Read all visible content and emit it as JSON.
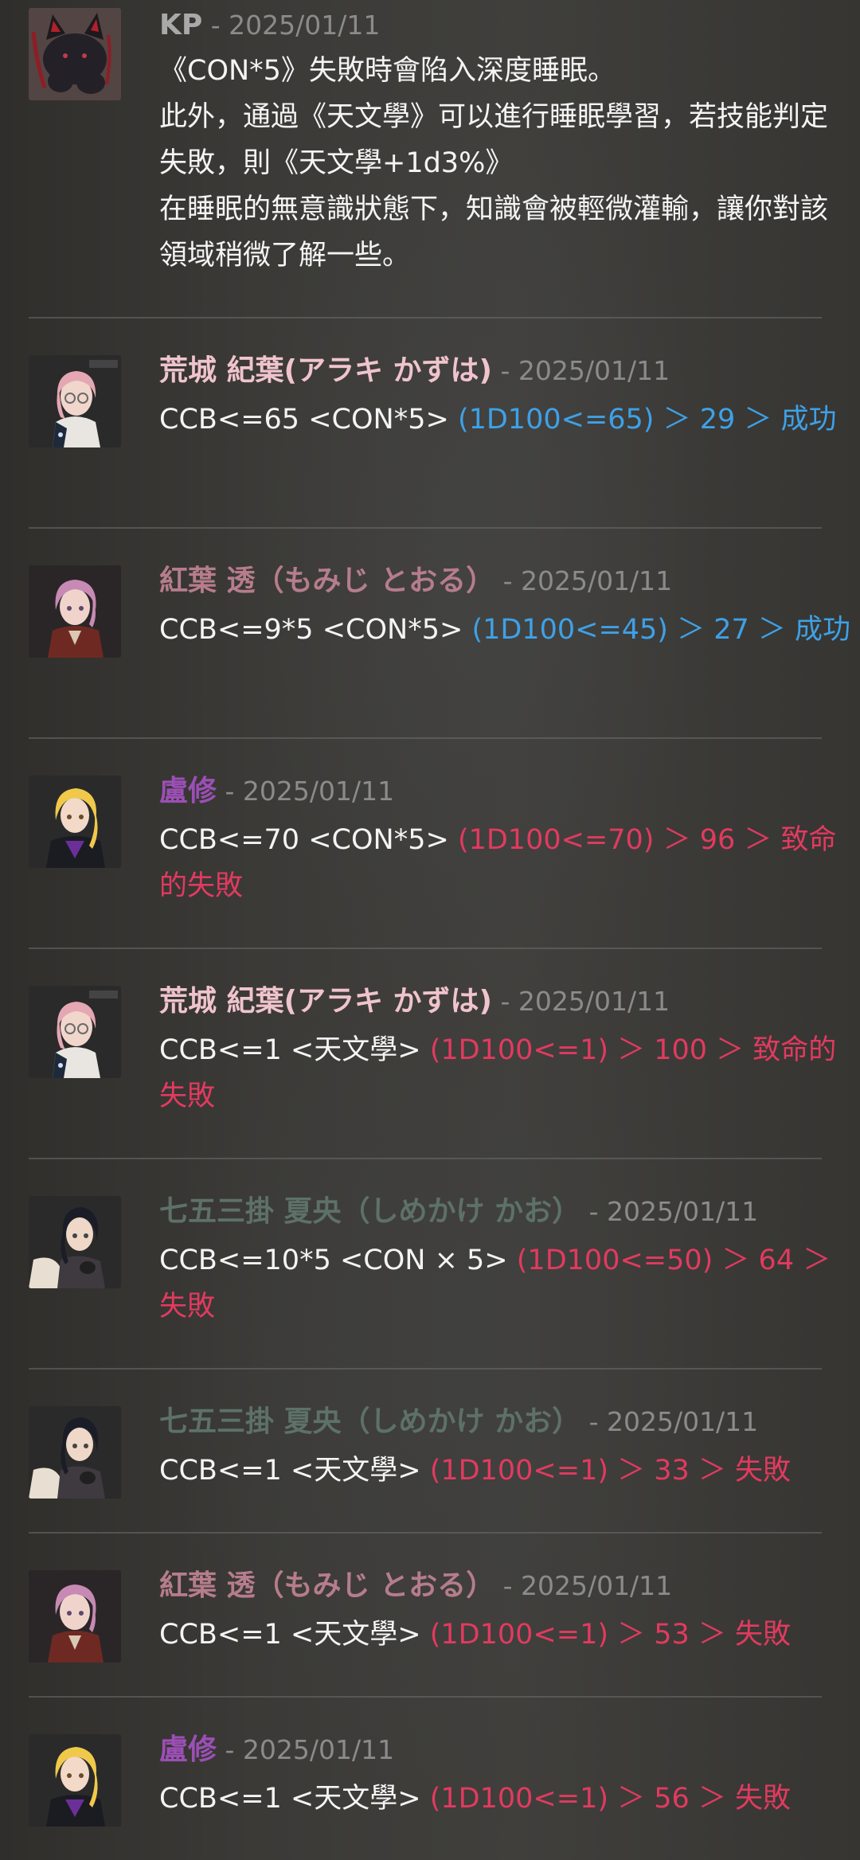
{
  "separator": " - ",
  "colors": {
    "success": "#3ea1e6",
    "failure": "#e23a5f",
    "kp": "#a9a9a9",
    "kazuha": "#f0c4cc",
    "toru": "#b67d8c",
    "roshu": "#9c4fb6",
    "kao": "#5d7168"
  },
  "messages": [
    {
      "author": "KP",
      "date": "2025/01/11",
      "lines": [
        "《CON*5》失敗時會陷入深度睡眠。",
        "此外，通過《天文學》可以進行睡眠學習，若技能判定失敗，則《天文學+1d3%》",
        "在睡眠的無意識狀態下，知識會被輕微灌輸，讓你對該領域稍微了解一些。"
      ]
    },
    {
      "author": "荒城 紀葉(アラキ かずは)",
      "date": "2025/01/11",
      "command": "CCB<=65 <CON*5>",
      "result": "(1D100<=65) ＞ 29 ＞ 成功"
    },
    {
      "author": "紅葉 透（もみじ とおる）",
      "date": "2025/01/11",
      "command": "CCB<=9*5 <CON*5>",
      "result": "(1D100<=45) ＞ 27 ＞ 成功"
    },
    {
      "author": "盧修",
      "date": "2025/01/11",
      "command": "CCB<=70 <CON*5>",
      "result": "(1D100<=70) ＞ 96 ＞ 致命的失敗"
    },
    {
      "author": "荒城 紀葉(アラキ かずは)",
      "date": "2025/01/11",
      "command": "CCB<=1 <天文學>",
      "result": "(1D100<=1) ＞ 100 ＞ 致命的失敗"
    },
    {
      "author": "七五三掛 夏央（しめかけ かお）",
      "date": "2025/01/11",
      "command": "CCB<=10*5 <CON × 5>",
      "result": "(1D100<=50) ＞ 64 ＞ 失敗"
    },
    {
      "author": "七五三掛 夏央（しめかけ かお）",
      "date": "2025/01/11",
      "command": "CCB<=1 <天文學>",
      "result": "(1D100<=1) ＞ 33 ＞ 失敗"
    },
    {
      "author": "紅葉 透（もみじ とおる）",
      "date": "2025/01/11",
      "command": "CCB<=1 <天文學>",
      "result": "(1D100<=1) ＞ 53 ＞ 失敗"
    },
    {
      "author": "盧修",
      "date": "2025/01/11",
      "command": "CCB<=1 <天文學>",
      "result": "(1D100<=1) ＞ 56 ＞ 失敗"
    }
  ]
}
